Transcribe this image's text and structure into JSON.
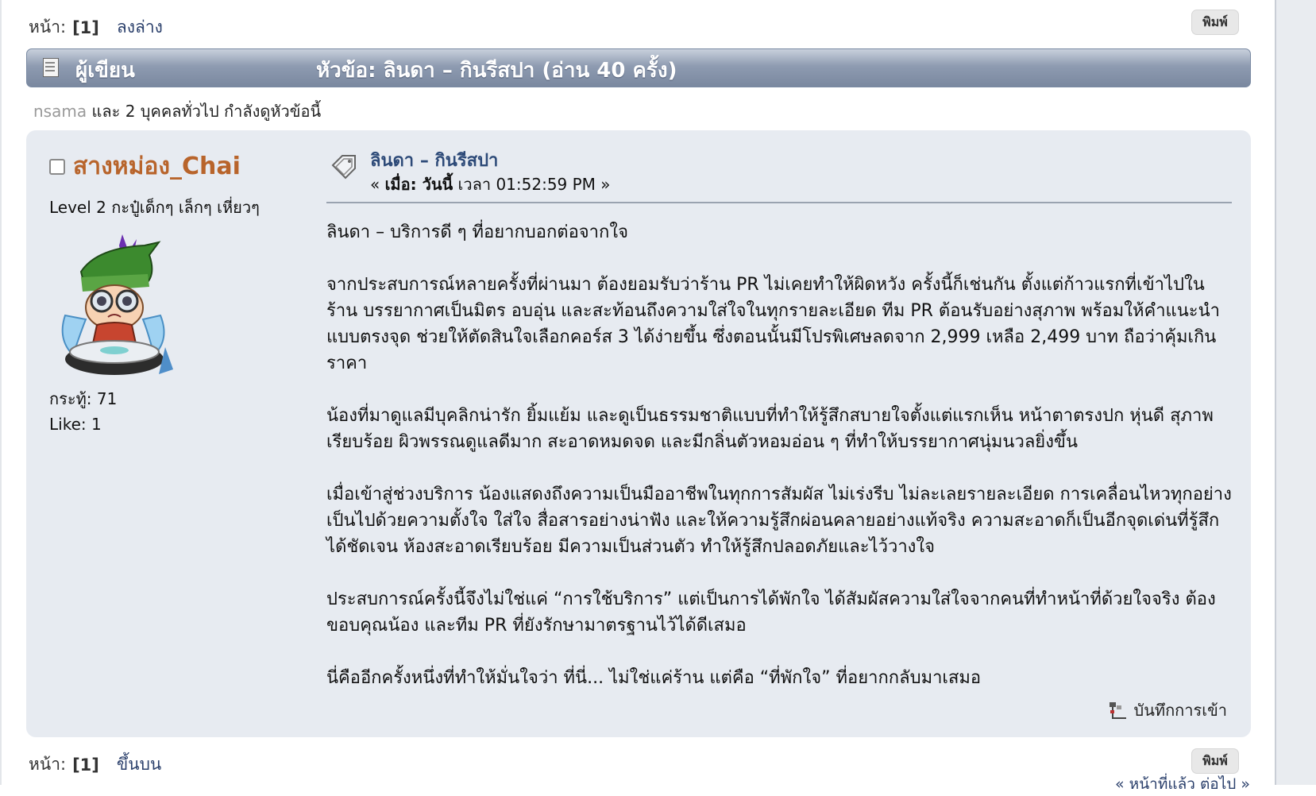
{
  "pagination_top": {
    "label": "หน้า:",
    "current": "[1]",
    "nav_link": "ลงล่าง"
  },
  "pagination_bottom": {
    "label": "หน้า:",
    "current": "[1]",
    "nav_link": "ขึ้นบน",
    "prev_next": "« หน้าที่แล้ว ต่อไป »"
  },
  "print_button": "พิมพ์",
  "header": {
    "author_label": "ผู้เขียน",
    "topic_title": "หัวข้อ: ลินดา – กินรีสปา  (อ่าน 40 ครั้ง)"
  },
  "viewing": {
    "viewer": "nsama",
    "text": " และ 2 บุคคลทั่วไป กำลังดูหัวข้อนี้"
  },
  "poster": {
    "name": "สางหม่อง_Chai",
    "level": "Level 2 กะปู๋เด็กๆ เล็กๆ เหี่ยวๆ",
    "posts": "กระทู้: 71",
    "likes": "Like: 1"
  },
  "post": {
    "subject": "ลินดา – กินรีสปา",
    "date_prefix": "« ",
    "date_label": "เมื่อ: วันนี้",
    "date_value": " เวลา 01:52:59 PM »",
    "paragraphs": [
      "ลินดา – บริการดี ๆ ที่อยากบอกต่อจากใจ",
      "จากประสบการณ์หลายครั้งที่ผ่านมา ต้องยอมรับว่าร้าน PR ไม่เคยทำให้ผิดหวัง ครั้งนี้ก็เช่นกัน ตั้งแต่ก้าวแรกที่เข้าไปในร้าน บรรยากาศเป็นมิตร อบอุ่น และสะท้อนถึงความใส่ใจในทุกรายละเอียด ทีม PR ต้อนรับอย่างสุภาพ พร้อมให้คำแนะนำแบบตรงจุด ช่วยให้ตัดสินใจเลือกคอร์ส 3 ได้ง่ายขึ้น ซึ่งตอนนั้นมีโปรพิเศษลดจาก 2,999 เหลือ 2,499 บาท ถือว่าคุ้มเกินราคา",
      "น้องที่มาดูแลมีบุคลิกน่ารัก ยิ้มแย้ม และดูเป็นธรรมชาติแบบที่ทำให้รู้สึกสบายใจตั้งแต่แรกเห็น หน้าตาตรงปก หุ่นดี สุภาพ เรียบร้อย ผิวพรรณดูแลดีมาก สะอาดหมดจด และมีกลิ่นตัวหอมอ่อน ๆ ที่ทำให้บรรยากาศนุ่มนวลยิ่งขึ้น",
      "เมื่อเข้าสู่ช่วงบริการ น้องแสดงถึงความเป็นมืออาชีพในทุกการสัมผัส ไม่เร่งรีบ ไม่ละเลยรายละเอียด การเคลื่อนไหวทุกอย่างเป็นไปด้วยความตั้งใจ ใส่ใจ สื่อสารอย่างน่าฟัง และให้ความรู้สึกผ่อนคลายอย่างแท้จริง ความสะอาดก็เป็นอีกจุดเด่นที่รู้สึกได้ชัดเจน ห้องสะอาดเรียบร้อย มีความเป็นส่วนตัว ทำให้รู้สึกปลอดภัยและไว้วางใจ",
      "ประสบการณ์ครั้งนี้จึงไม่ใช่แค่ “การใช้บริการ” แต่เป็นการได้พักใจ ได้สัมผัสความใส่ใจจากคนที่ทำหน้าที่ด้วยใจจริง ต้องขอบคุณน้อง และทีม PR ที่ยังรักษามาตรฐานไว้ได้ดีเสมอ",
      "นี่คืออีกครั้งหนึ่งที่ทำให้มั่นใจว่า ที่นี่... ไม่ใช่แค่ร้าน แต่คือ “ที่พักใจ” ที่อยากกลับมาเสมอ"
    ],
    "logged_ip": "บันทึกการเข้า"
  }
}
